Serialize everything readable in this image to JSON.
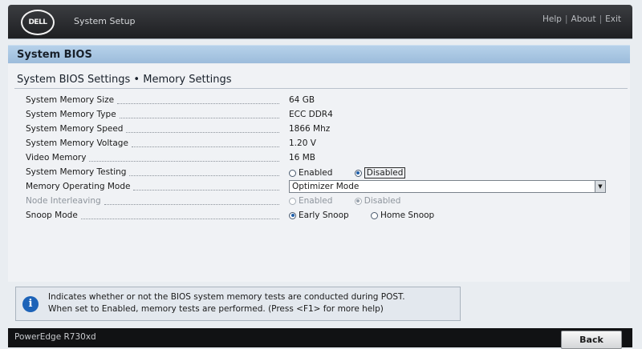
{
  "header": {
    "logo_text": "DELL",
    "app_title": "System Setup",
    "links": [
      "Help",
      "About",
      "Exit"
    ],
    "separator": "|"
  },
  "section": {
    "title": "System BIOS"
  },
  "page": {
    "title": "System BIOS Settings • Memory Settings"
  },
  "settings": {
    "memory_size": {
      "label": "System Memory Size",
      "value": "64 GB"
    },
    "memory_type": {
      "label": "System Memory Type",
      "value": "ECC DDR4"
    },
    "memory_speed": {
      "label": "System Memory Speed",
      "value": "1866 Mhz"
    },
    "memory_voltage": {
      "label": "System Memory Voltage",
      "value": "1.20 V"
    },
    "video_memory": {
      "label": "Video Memory",
      "value": "16 MB"
    },
    "memory_testing": {
      "label": "System Memory Testing",
      "options": [
        "Enabled",
        "Disabled"
      ],
      "selected": "Disabled"
    },
    "operating_mode": {
      "label": "Memory Operating Mode",
      "value": "Optimizer Mode"
    },
    "node_interleaving": {
      "label": "Node Interleaving",
      "options": [
        "Enabled",
        "Disabled"
      ],
      "selected": "Disabled"
    },
    "snoop_mode": {
      "label": "Snoop Mode",
      "options": [
        "Early Snoop",
        "Home Snoop"
      ],
      "selected": "Early Snoop"
    }
  },
  "help": {
    "icon": "info-icon",
    "line1": "Indicates whether or not the BIOS system memory tests are conducted during POST.",
    "line2": "When set to Enabled, memory tests are performed. (Press <F1> for more help)"
  },
  "footer": {
    "model": "PowerEdge R730xd",
    "back_label": "Back"
  },
  "colors": {
    "header_bg": "#2a2c30",
    "section_band": "#a9c6e2",
    "radio_selected": "#1f5faa",
    "info_icon": "#1d63b8"
  }
}
